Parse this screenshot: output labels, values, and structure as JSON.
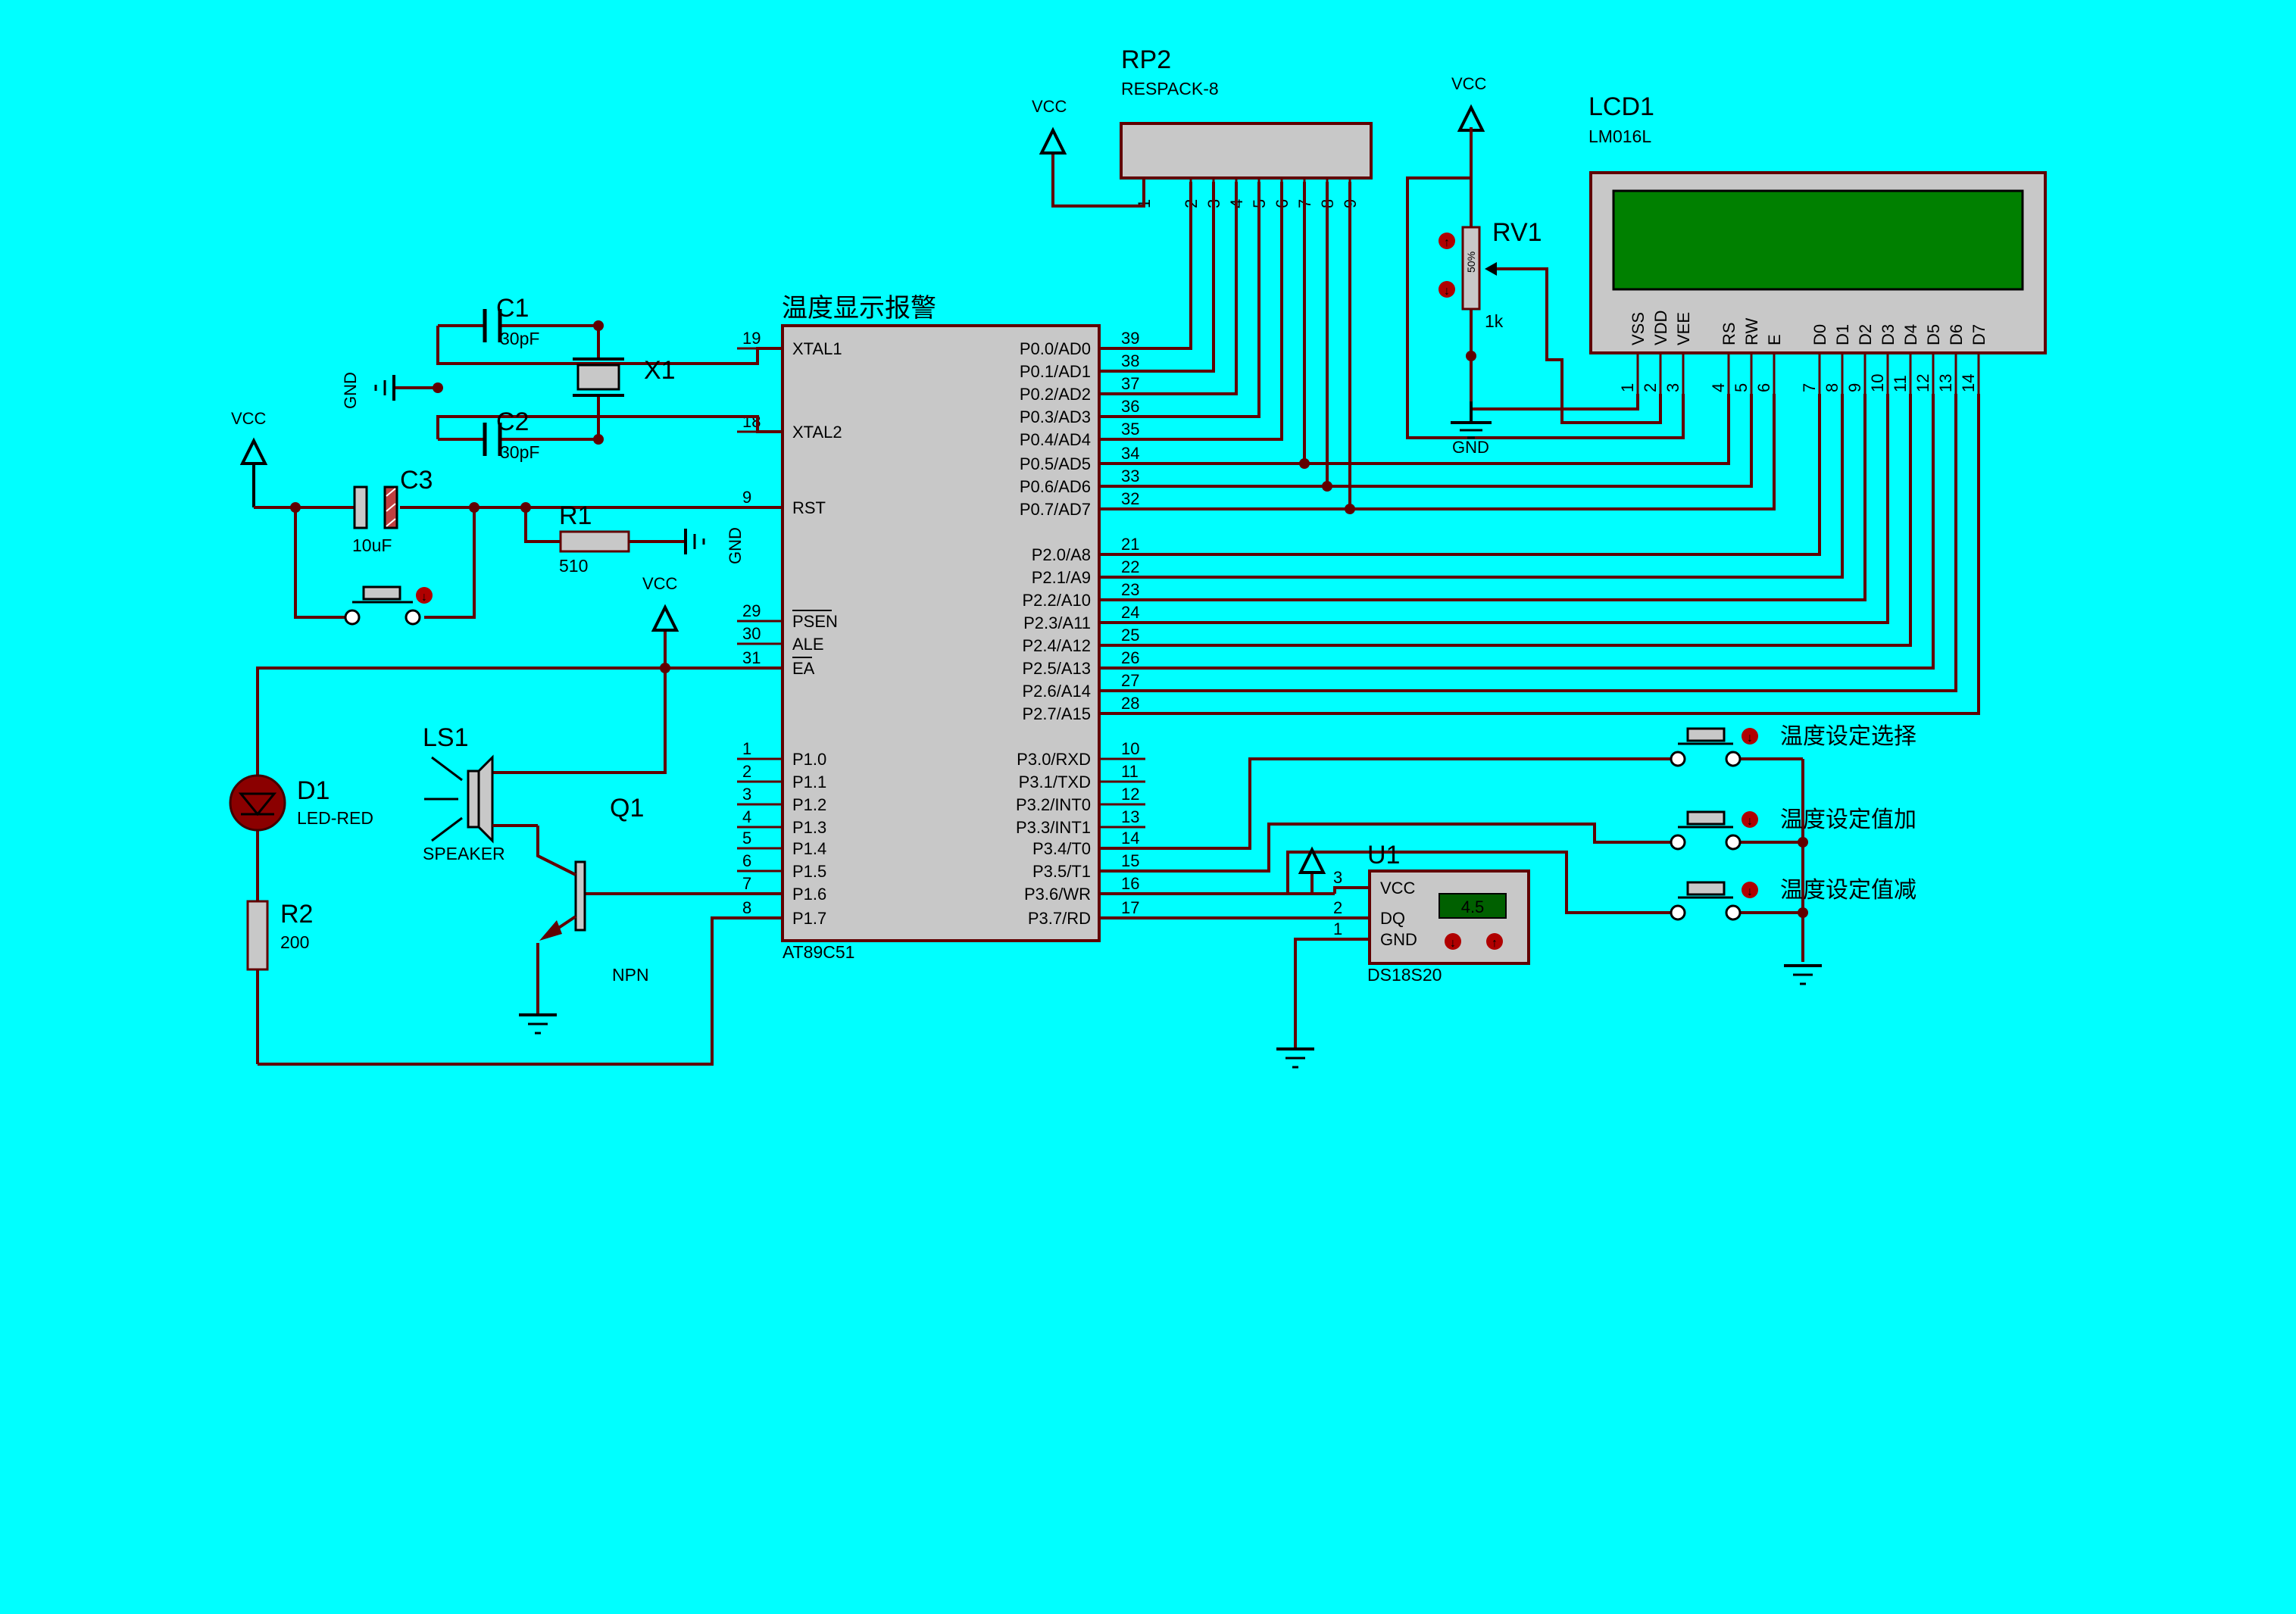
{
  "title": "温度显示报警",
  "mcu": {
    "name": "AT89C51",
    "left_pins": [
      {
        "n": "19",
        "name": "XTAL1"
      },
      {
        "n": "18",
        "name": "XTAL2"
      },
      {
        "n": "9",
        "name": "RST"
      },
      {
        "n": "29",
        "name": "PSEN"
      },
      {
        "n": "30",
        "name": "ALE"
      },
      {
        "n": "31",
        "name": "EA"
      },
      {
        "n": "1",
        "name": "P1.0"
      },
      {
        "n": "2",
        "name": "P1.1"
      },
      {
        "n": "3",
        "name": "P1.2"
      },
      {
        "n": "4",
        "name": "P1.3"
      },
      {
        "n": "5",
        "name": "P1.4"
      },
      {
        "n": "6",
        "name": "P1.5"
      },
      {
        "n": "7",
        "name": "P1.6"
      },
      {
        "n": "8",
        "name": "P1.7"
      }
    ],
    "right_pins": [
      {
        "n": "39",
        "name": "P0.0/AD0"
      },
      {
        "n": "38",
        "name": "P0.1/AD1"
      },
      {
        "n": "37",
        "name": "P0.2/AD2"
      },
      {
        "n": "36",
        "name": "P0.3/AD3"
      },
      {
        "n": "35",
        "name": "P0.4/AD4"
      },
      {
        "n": "34",
        "name": "P0.5/AD5"
      },
      {
        "n": "33",
        "name": "P0.6/AD6"
      },
      {
        "n": "32",
        "name": "P0.7/AD7"
      },
      {
        "n": "21",
        "name": "P2.0/A8"
      },
      {
        "n": "22",
        "name": "P2.1/A9"
      },
      {
        "n": "23",
        "name": "P2.2/A10"
      },
      {
        "n": "24",
        "name": "P2.3/A11"
      },
      {
        "n": "25",
        "name": "P2.4/A12"
      },
      {
        "n": "26",
        "name": "P2.5/A13"
      },
      {
        "n": "27",
        "name": "P2.6/A14"
      },
      {
        "n": "28",
        "name": "P2.7/A15"
      },
      {
        "n": "10",
        "name": "P3.0/RXD"
      },
      {
        "n": "11",
        "name": "P3.1/TXD"
      },
      {
        "n": "12",
        "name": "P3.2/INT0"
      },
      {
        "n": "13",
        "name": "P3.3/INT1"
      },
      {
        "n": "14",
        "name": "P3.4/T0"
      },
      {
        "n": "15",
        "name": "P3.5/T1"
      },
      {
        "n": "16",
        "name": "P3.6/WR"
      },
      {
        "n": "17",
        "name": "P3.7/RD"
      }
    ]
  },
  "rp2": {
    "ref": "RP2",
    "value": "RESPACK-8",
    "pins": [
      "1",
      "2",
      "3",
      "4",
      "5",
      "6",
      "7",
      "8",
      "9"
    ]
  },
  "lcd": {
    "ref": "LCD1",
    "value": "LM016L",
    "pins": [
      {
        "n": "1",
        "name": "VSS"
      },
      {
        "n": "2",
        "name": "VDD"
      },
      {
        "n": "3",
        "name": "VEE"
      },
      {
        "n": "4",
        "name": "RS"
      },
      {
        "n": "5",
        "name": "RW"
      },
      {
        "n": "6",
        "name": "E"
      },
      {
        "n": "7",
        "name": "D0"
      },
      {
        "n": "8",
        "name": "D1"
      },
      {
        "n": "9",
        "name": "D2"
      },
      {
        "n": "10",
        "name": "D3"
      },
      {
        "n": "11",
        "name": "D4"
      },
      {
        "n": "12",
        "name": "D5"
      },
      {
        "n": "13",
        "name": "D6"
      },
      {
        "n": "14",
        "name": "D7"
      }
    ]
  },
  "rv1": {
    "ref": "RV1",
    "value": "1k",
    "percent": "50%"
  },
  "c1": {
    "ref": "C1",
    "value": "30pF"
  },
  "c2": {
    "ref": "C2",
    "value": "30pF"
  },
  "c3": {
    "ref": "C3",
    "value": "10uF"
  },
  "x1": {
    "ref": "X1"
  },
  "r1": {
    "ref": "R1",
    "value": "510"
  },
  "r2": {
    "ref": "R2",
    "value": "200"
  },
  "d1": {
    "ref": "D1",
    "value": "LED-RED"
  },
  "ls1": {
    "ref": "LS1",
    "value": "SPEAKER"
  },
  "q1": {
    "ref": "Q1",
    "value": "NPN"
  },
  "u1": {
    "ref": "U1",
    "value": "DS18S20",
    "reading": "4.5",
    "pins": [
      {
        "n": "3",
        "name": "VCC"
      },
      {
        "n": "2",
        "name": "DQ"
      },
      {
        "n": "1",
        "name": "GND"
      }
    ]
  },
  "buttons": [
    "温度设定选择",
    "温度设定值加",
    "温度设定值减"
  ],
  "power": {
    "vcc": "VCC",
    "gnd": "GND"
  },
  "colors": {
    "background": "#00FFFF",
    "wire": "#600000",
    "body": "#C8C8C8",
    "lcd_screen": "#008000"
  }
}
